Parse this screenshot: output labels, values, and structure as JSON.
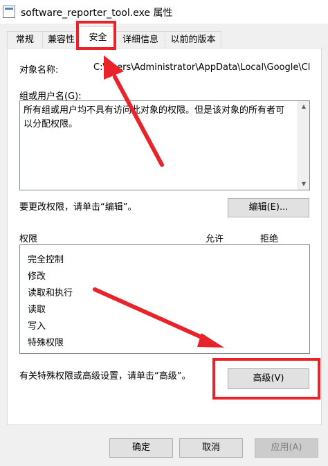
{
  "window": {
    "title": "software_reporter_tool.exe 属性",
    "icon": "exe-file-icon"
  },
  "tabs": [
    {
      "label": "常规",
      "active": false
    },
    {
      "label": "兼容性",
      "active": false
    },
    {
      "label": "安全",
      "active": true
    },
    {
      "label": "详细信息",
      "active": false
    },
    {
      "label": "以前的版本",
      "active": false
    }
  ],
  "security": {
    "object_name_label": "对象名称:",
    "object_name_value": "C:\\Users\\Administrator\\AppData\\Local\\Google\\Cl",
    "groups_label": "组或用户名(G):",
    "groups_message": "所有组或用户均不具有访问此对象的权限。但是该对象的所有者可以分配权限。",
    "edit_hint": "要更改权限，请单击“编辑”。",
    "edit_button": "编辑(E)...",
    "permissions_header": "权限",
    "allow_header": "允许",
    "deny_header": "拒绝",
    "permissions": [
      "完全控制",
      "修改",
      "读取和执行",
      "读取",
      "写入",
      "特殊权限"
    ],
    "advanced_hint": "有关特殊权限或高级设置，请单击“高级”。",
    "advanced_button": "高级(V)"
  },
  "footer": {
    "ok": "确定",
    "cancel": "取消",
    "apply": "应用(A)"
  },
  "annotation_color": "#e8232a"
}
